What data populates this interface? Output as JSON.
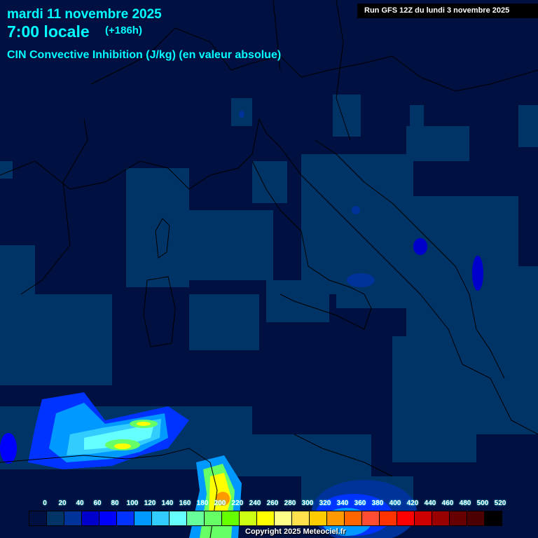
{
  "header": {
    "date": "mardi 11 novembre 2025",
    "time": "7:00 locale",
    "lead": "(+186h)",
    "variable": "CIN Convective Inhibition (J/kg) (en valeur absolue)",
    "run": "Run GFS 12Z du lundi 3 novembre 2025"
  },
  "legend": {
    "labels": [
      "0",
      "20",
      "40",
      "60",
      "80",
      "100",
      "120",
      "140",
      "160",
      "180",
      "200",
      "220",
      "240",
      "260",
      "280",
      "300",
      "320",
      "340",
      "360",
      "380",
      "400",
      "420",
      "440",
      "460",
      "480",
      "500",
      "520"
    ],
    "colors": [
      "#001040",
      "#003366",
      "#003399",
      "#0000cc",
      "#0000ff",
      "#0033ff",
      "#0099ff",
      "#33ccff",
      "#66ffff",
      "#66ff99",
      "#66ff66",
      "#66ff00",
      "#ccff11",
      "#ffff00",
      "#ffff88",
      "#ffe04d",
      "#ffcc00",
      "#ff9900",
      "#ff6600",
      "#ff4d33",
      "#ff3300",
      "#ff0000",
      "#cc0000",
      "#990000",
      "#660000",
      "#4d0000",
      "#000000"
    ]
  },
  "copyright": "Copyright 2025 Meteociel.fr"
}
